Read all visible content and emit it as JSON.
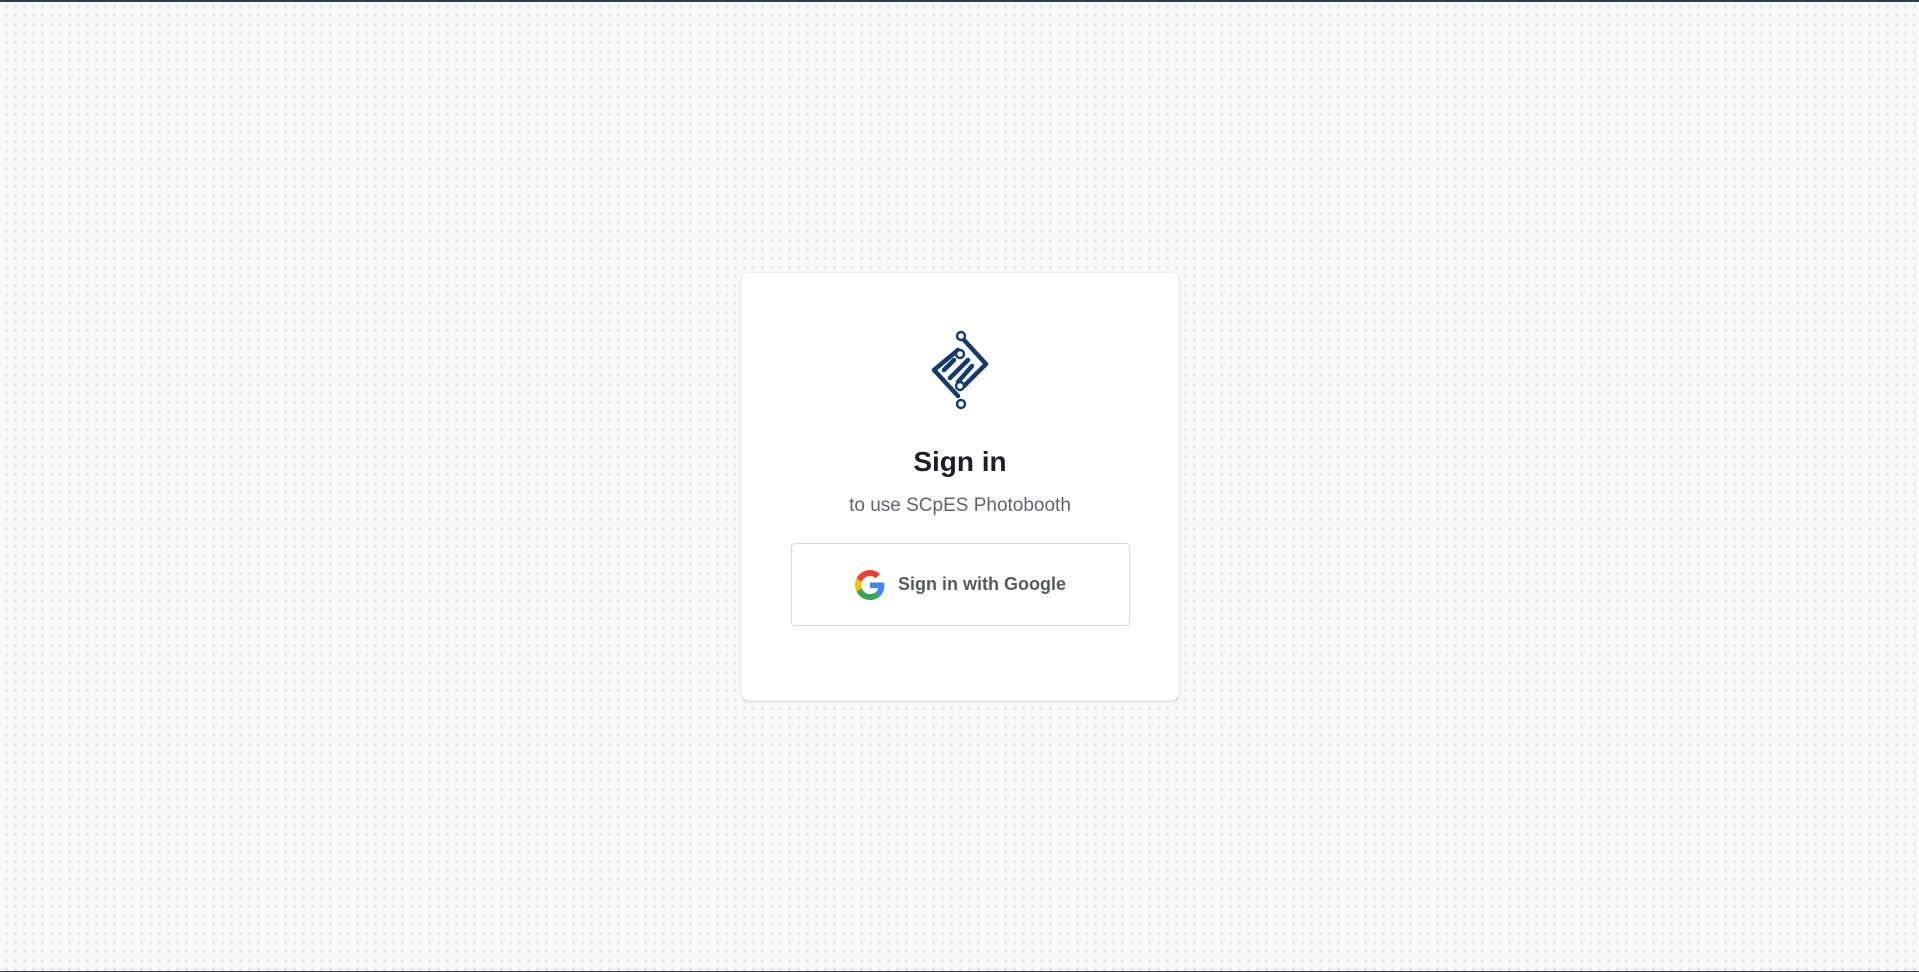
{
  "auth": {
    "title": "Sign in",
    "subtitle": "to use SCpES Photobooth",
    "google_button_label": "Sign in with Google"
  },
  "icons": {
    "logo": "scpes-logo-icon",
    "google": "google-icon"
  },
  "colors": {
    "background": "#f6f7f9",
    "card": "#ffffff",
    "logo": "#123a6b",
    "title": "#1d1f24",
    "subtitle": "#5f6470",
    "button_text": "#555a62",
    "button_border": "#d5d8dd",
    "google_blue": "#4285F4",
    "google_green": "#34A853",
    "google_yellow": "#FBBC05",
    "google_red": "#EA4335"
  }
}
